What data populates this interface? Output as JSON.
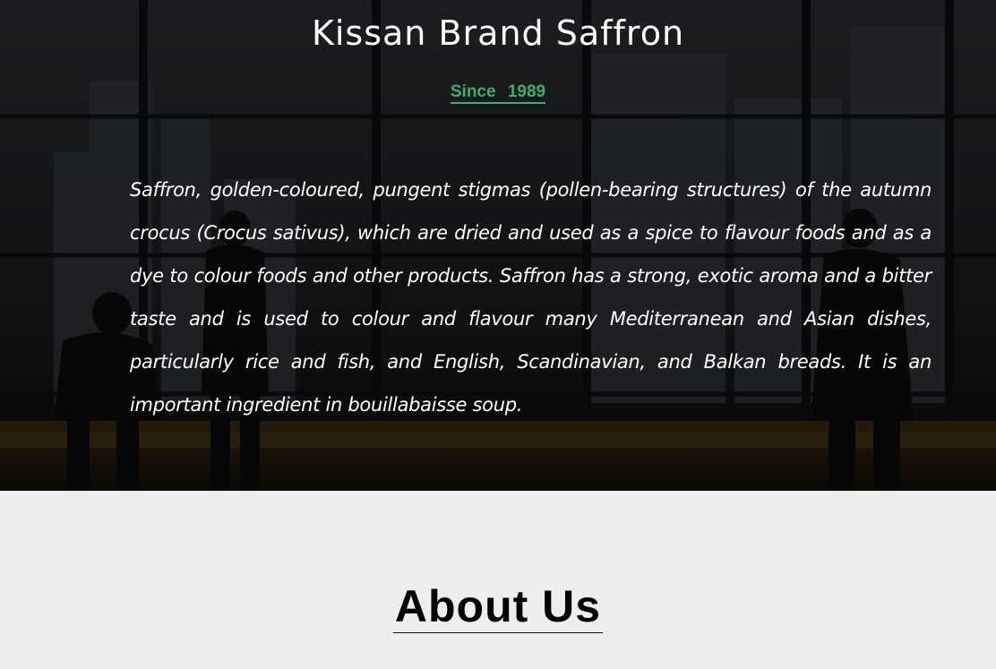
{
  "hero": {
    "title": "Kissan Brand Saffron",
    "since_link": "Since 1989",
    "description": "Saffron, golden-coloured, pungent stigmas (pollen-bearing structures) of the autumn crocus (Crocus sativus), which are dried and used as a spice to flavour foods and as a dye to colour foods and other products. Saffron has a strong, exotic aroma and a bitter taste and is used to colour and flavour many Mediterranean and Asian dishes, particularly rice and fish, and English, Scandinavian, and Balkan breads. It is an important ingredient in bouillabaisse soup."
  },
  "about": {
    "heading": "About Us"
  },
  "colors": {
    "accent_green": "#3fae6a",
    "hero_overlay": "#0c0c0d",
    "section_bg": "#eeeeee"
  }
}
